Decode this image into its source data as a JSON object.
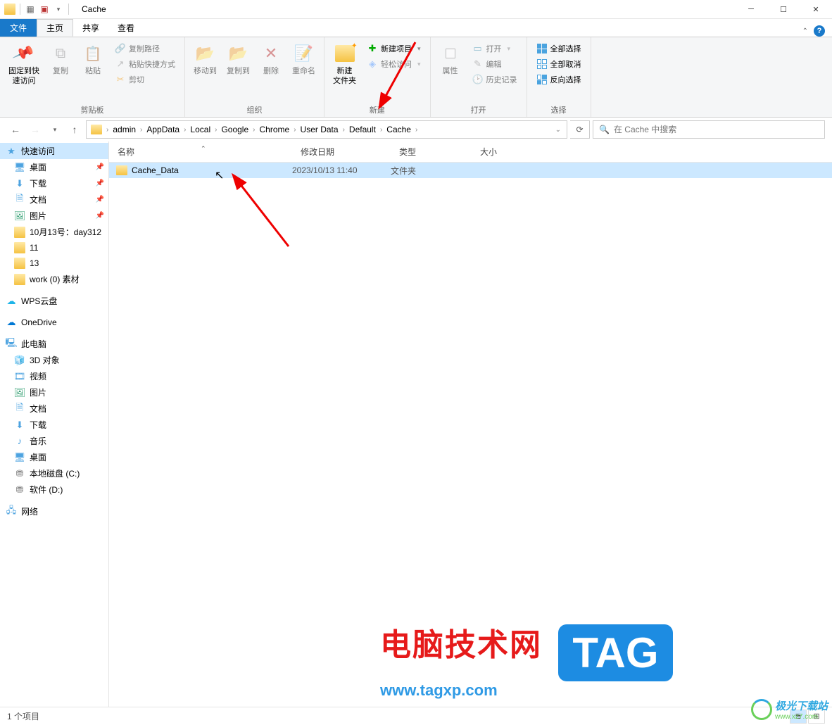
{
  "window": {
    "title": "Cache"
  },
  "tabs": {
    "file": "文件",
    "home": "主页",
    "share": "共享",
    "view": "查看"
  },
  "ribbon": {
    "clipboard": {
      "pin": "固定到快\n速访问",
      "copy": "复制",
      "paste": "粘贴",
      "copypath": "复制路径",
      "pasteshortcut": "粘贴快捷方式",
      "cut": "剪切",
      "group": "剪贴板"
    },
    "organize": {
      "moveto": "移动到",
      "copyto": "复制到",
      "delete": "删除",
      "rename": "重命名",
      "group": "组织"
    },
    "new": {
      "newfolder": "新建\n文件夹",
      "newitem": "新建项目",
      "easyaccess": "轻松访问",
      "group": "新建"
    },
    "open": {
      "properties": "属性",
      "open": "打开",
      "edit": "编辑",
      "history": "历史记录",
      "group": "打开"
    },
    "select": {
      "selectall": "全部选择",
      "selectnone": "全部取消",
      "invert": "反向选择",
      "group": "选择"
    }
  },
  "breadcrumbs": [
    "admin",
    "AppData",
    "Local",
    "Google",
    "Chrome",
    "User Data",
    "Default",
    "Cache"
  ],
  "search": {
    "placeholder": "在 Cache 中搜索"
  },
  "columns": {
    "name": "名称",
    "date": "修改日期",
    "type": "类型",
    "size": "大小"
  },
  "files": [
    {
      "name": "Cache_Data",
      "date": "2023/10/13 11:40",
      "type": "文件夹",
      "size": ""
    }
  ],
  "sidebar": {
    "quickaccess": "快速访问",
    "desktop": "桌面",
    "downloads": "下载",
    "documents": "文档",
    "pictures": "图片",
    "oct13": "10月13号：day312",
    "f11": "11",
    "f13": "13",
    "work": "work (0) 素材",
    "wps": "WPS云盘",
    "onedrive": "OneDrive",
    "thispc": "此电脑",
    "obj3d": "3D 对象",
    "videos": "视频",
    "pictures2": "图片",
    "documents2": "文档",
    "downloads2": "下载",
    "music": "音乐",
    "desktop2": "桌面",
    "diskC": "本地磁盘 (C:)",
    "diskD": "软件 (D:)",
    "network": "网络"
  },
  "status": {
    "items": "1 个项目"
  },
  "watermark": {
    "big": "电脑技术网",
    "tag": "TAG",
    "url": "www.tagxp.com",
    "brand": "极光下载站",
    "brandurl": "www.xz7.com"
  }
}
